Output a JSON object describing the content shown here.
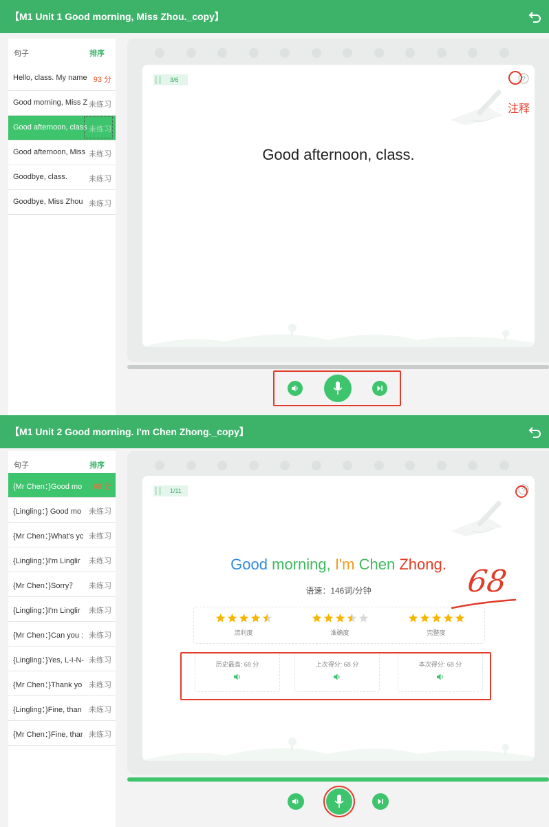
{
  "colors": {
    "header": "#3db36a",
    "accent": "#3ec46d",
    "score_red": "#e8542c",
    "annotation_red": "#e23b2a",
    "star": "#f6b500"
  },
  "panel1": {
    "title": "【M1 Unit 1 Good morning, Miss Zhou._copy】",
    "sidebar_header": {
      "col1": "句子",
      "col2": "排序"
    },
    "items": [
      {
        "text": "Hello, class. My name",
        "status": "93 分",
        "scored": true
      },
      {
        "text": "Good morning, Miss Z",
        "status": "未练习",
        "scored": false
      },
      {
        "text": "Good afternoon, class",
        "status": "未练习",
        "scored": false,
        "selected": true
      },
      {
        "text": "Good afternoon, Miss",
        "status": "未练习",
        "scored": false
      },
      {
        "text": "Goodbye, class.",
        "status": "未练习",
        "scored": false
      },
      {
        "text": "Goodbye, Miss Zhou",
        "status": "未练习",
        "scored": false
      }
    ],
    "page_indicator": "3/6",
    "annotation": "注释",
    "sentence": "Good afternoon, class.",
    "icons": {
      "back": "back-arrow-icon",
      "help": "question-icon",
      "play": "speaker-icon",
      "record": "microphone-icon",
      "next": "skip-next-icon"
    }
  },
  "panel2": {
    "title": "【M1 Unit 2 Good morning. I'm Chen Zhong._copy】",
    "sidebar_header": {
      "col1": "句子",
      "col2": "排序"
    },
    "items": [
      {
        "text": "{Mr Chen：}Good mo",
        "status": "68 分",
        "scored": true,
        "selected": true
      },
      {
        "text": "{Lingling：} Good mo",
        "status": "未练习",
        "scored": false
      },
      {
        "text": "{Mr Chen：}What's yc",
        "status": "未练习",
        "scored": false
      },
      {
        "text": "{Lingling：}I'm Linglir",
        "status": "未练习",
        "scored": false
      },
      {
        "text": "{Mr Chen：}Sorry？",
        "status": "未练习",
        "scored": false
      },
      {
        "text": "{Lingling：}I'm Linglir",
        "status": "未练习",
        "scored": false
      },
      {
        "text": "{Mr Chen：}Can you :",
        "status": "未练习",
        "scored": false
      },
      {
        "text": "{Lingling：}Yes, L-I-N-",
        "status": "未练习",
        "scored": false
      },
      {
        "text": "{Mr Chen：}Thank yo",
        "status": "未练习",
        "scored": false
      },
      {
        "text": "{Lingling：}Fine, than",
        "status": "未练习",
        "scored": false
      },
      {
        "text": "{Mr Chen：}Fine, thar",
        "status": "未练习",
        "scored": false
      }
    ],
    "page_indicator": "1/11",
    "sentence_words": [
      {
        "w": "Good",
        "color": "blue"
      },
      {
        "w": " "
      },
      {
        "w": "morning,",
        "color": "green"
      },
      {
        "w": " "
      },
      {
        "w": "I'm",
        "color": "orange"
      },
      {
        "w": " "
      },
      {
        "w": "Chen",
        "color": "green"
      },
      {
        "w": " "
      },
      {
        "w": "Zhong.",
        "color": "red"
      }
    ],
    "handwritten_score": "68",
    "speed": "语速：146词/分钟",
    "ratings": [
      {
        "label": "流利度",
        "stars": 4.5
      },
      {
        "label": "准确度",
        "stars": 3.5
      },
      {
        "label": "完整度",
        "stars": 5
      }
    ],
    "scores": [
      {
        "label": "历史最高: 68 分"
      },
      {
        "label": "上次得分: 68 分"
      },
      {
        "label": "本次得分: 68 分"
      }
    ],
    "progress": 1.0
  }
}
